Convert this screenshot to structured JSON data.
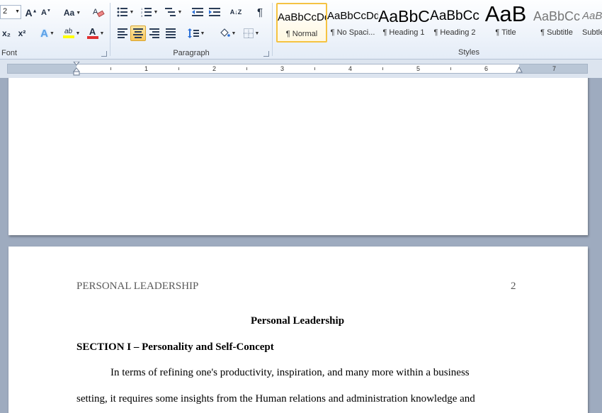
{
  "ribbon": {
    "font_group": {
      "label": "Font",
      "font_size": "2",
      "grow_font_icon": "grow-font-icon",
      "shrink_font_icon": "shrink-font-icon",
      "change_case": "Aa",
      "subscript": "x₂",
      "superscript": "x²",
      "text_effects": "A",
      "highlight": "ab",
      "font_color": "A",
      "highlight_color": "#ffff00",
      "font_color_value": "#e03030"
    },
    "paragraph_group": {
      "label": "Paragraph",
      "sort_label": "A↓Z",
      "show_marks": "¶"
    },
    "styles_group": {
      "label": "Styles",
      "styles": [
        {
          "sample": "AaBbCcDd",
          "name": "¶ Normal",
          "selected": true
        },
        {
          "sample": "AaBbCcDd",
          "name": "¶ No Spaci...",
          "selected": false
        },
        {
          "sample": "AaBbCc",
          "name": "¶ Heading 1",
          "selected": false
        },
        {
          "sample": "AaBbCc",
          "name": "¶ Heading 2",
          "selected": false
        },
        {
          "sample": "AaB",
          "name": "¶ Title",
          "selected": false
        },
        {
          "sample": "AaBbCc",
          "name": "¶ Subtitle",
          "selected": false
        },
        {
          "sample": "AaBbCc",
          "name": "Subtle",
          "selected": false
        }
      ]
    }
  },
  "ruler": {
    "numbers": [
      "1",
      "2",
      "3",
      "4",
      "5",
      "6",
      "7"
    ]
  },
  "document": {
    "page2": {
      "running_head": "PERSONAL LEADERSHIP",
      "page_number": "2",
      "title": "Personal Leadership",
      "section_heading": "SECTION I – Personality and Self-Concept",
      "para_line1": "In terms of refining one's productivity, inspiration, and many more within a business",
      "para_line2": "setting, it requires some insights from the Human relations and administration knowledge and"
    }
  }
}
